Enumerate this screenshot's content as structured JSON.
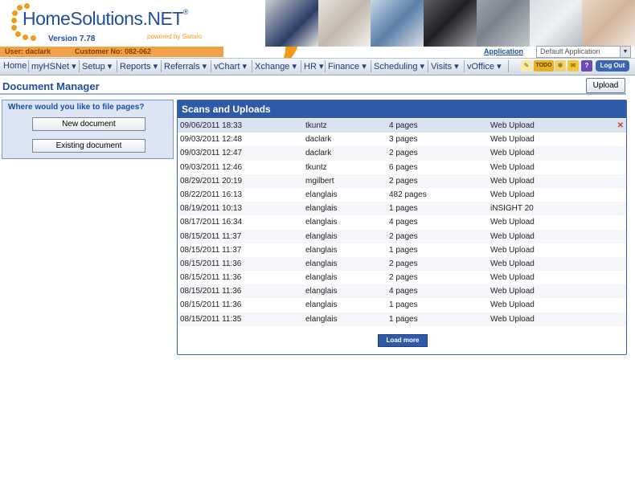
{
  "brand": {
    "name": "HomeSolutions.NET",
    "trademark": "®",
    "version": "Version 7.78",
    "powered_by": "powered by Sansio"
  },
  "user_bar": {
    "user": "User: daclark",
    "customer": "Customer No: 082-062"
  },
  "application": {
    "label": "Application",
    "selected": "Default Application"
  },
  "nav": {
    "items": [
      {
        "label": "Home"
      },
      {
        "label": "myHSNet ▾"
      },
      {
        "label": "Setup ▾"
      },
      {
        "label": "Reports ▾"
      },
      {
        "label": "Referrals ▾"
      },
      {
        "label": "vChart ▾"
      },
      {
        "label": "Xchange ▾"
      },
      {
        "label": "HR ▾"
      },
      {
        "label": "Finance ▾"
      },
      {
        "label": "Scheduling ▾"
      },
      {
        "label": "Visits ▾"
      },
      {
        "label": "vOffice ▾"
      }
    ],
    "tools": {
      "pencil": "✎",
      "todo": "TODO",
      "gear": "✻",
      "note": "✉",
      "help": "?"
    },
    "logout": "Log Out"
  },
  "page": {
    "title": "Document Manager",
    "upload_button": "Upload"
  },
  "file_panel": {
    "title": "Where would you like to file pages?",
    "new_document": "New document",
    "existing_document": "Existing document"
  },
  "scans": {
    "title": "Scans and Uploads",
    "rows": [
      {
        "date": "09/06/2011 18:33",
        "user": "tkuntz",
        "pages": "4 pages",
        "source": "Web Upload"
      },
      {
        "date": "09/03/2011 12:48",
        "user": "daclark",
        "pages": "3 pages",
        "source": "Web Upload"
      },
      {
        "date": "09/03/2011 12:47",
        "user": "daclark",
        "pages": "2 pages",
        "source": "Web Upload"
      },
      {
        "date": "09/03/2011 12:46",
        "user": "tkuntz",
        "pages": "6 pages",
        "source": "Web Upload"
      },
      {
        "date": "08/29/2011 20:19",
        "user": "mgilbert",
        "pages": "2 pages",
        "source": "Web Upload"
      },
      {
        "date": "08/22/2011 16:13",
        "user": "elanglais",
        "pages": "482 pages",
        "source": "Web Upload"
      },
      {
        "date": "08/19/2011 10:13",
        "user": "elanglais",
        "pages": "1 pages",
        "source": "iNSIGHT 20"
      },
      {
        "date": "08/17/2011 16:34",
        "user": "elanglais",
        "pages": "4 pages",
        "source": "Web Upload"
      },
      {
        "date": "08/15/2011 11:37",
        "user": "elanglais",
        "pages": "2 pages",
        "source": "Web Upload"
      },
      {
        "date": "08/15/2011 11:37",
        "user": "elanglais",
        "pages": "1 pages",
        "source": "Web Upload"
      },
      {
        "date": "08/15/2011 11:36",
        "user": "elanglais",
        "pages": "2 pages",
        "source": "Web Upload"
      },
      {
        "date": "08/15/2011 11:36",
        "user": "elanglais",
        "pages": "2 pages",
        "source": "Web Upload"
      },
      {
        "date": "08/15/2011 11:36",
        "user": "elanglais",
        "pages": "4 pages",
        "source": "Web Upload"
      },
      {
        "date": "08/15/2011 11:36",
        "user": "elanglais",
        "pages": "1 pages",
        "source": "Web Upload"
      },
      {
        "date": "08/15/2011 11:35",
        "user": "elanglais",
        "pages": "1 pages",
        "source": "Web Upload"
      }
    ],
    "delete_icon": "✕",
    "load_more": "Load more"
  },
  "colors": {
    "brand_blue": "#1e4fa0",
    "brand_orange": "#f29a1a",
    "panel_header": "#2f5aa8"
  }
}
